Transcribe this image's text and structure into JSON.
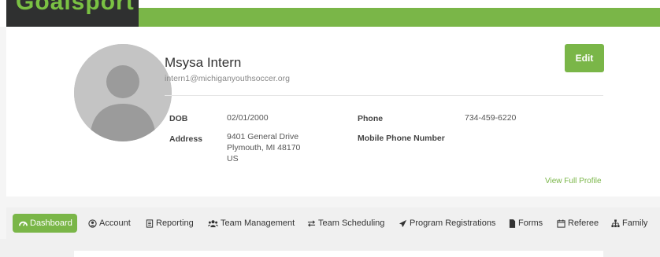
{
  "header": {
    "logo_text": "Goalsport"
  },
  "profile": {
    "name": "Msysa Intern",
    "email": "intern1@michiganyouthsoccer.org",
    "edit_label": "Edit",
    "dob_label": "DOB",
    "dob_value": "02/01/2000",
    "address_label": "Address",
    "address_line1": "9401 General Drive",
    "address_line2": "Plymouth, MI 48170",
    "address_line3": "US",
    "phone_label": "Phone",
    "phone_value": "734-459-6220",
    "mobile_label": "Mobile Phone Number",
    "view_full_profile": "View Full Profile"
  },
  "nav": {
    "items": [
      {
        "label": "Dashboard",
        "icon": "dashboard-icon"
      },
      {
        "label": "Account",
        "icon": "user-circle-icon"
      },
      {
        "label": "Reporting",
        "icon": "report-icon"
      },
      {
        "label": "Team Management",
        "icon": "users-icon"
      },
      {
        "label": "Team Scheduling",
        "icon": "exchange-icon"
      },
      {
        "label": "Program Registrations",
        "icon": "paper-plane-icon"
      },
      {
        "label": "Forms",
        "icon": "file-icon"
      },
      {
        "label": "Referee",
        "icon": "calendar-icon"
      },
      {
        "label": "Family",
        "icon": "sitemap-icon"
      }
    ]
  },
  "colors": {
    "accent": "#7ab648",
    "header_dark": "#2f3030",
    "background": "#f5f5f5"
  }
}
